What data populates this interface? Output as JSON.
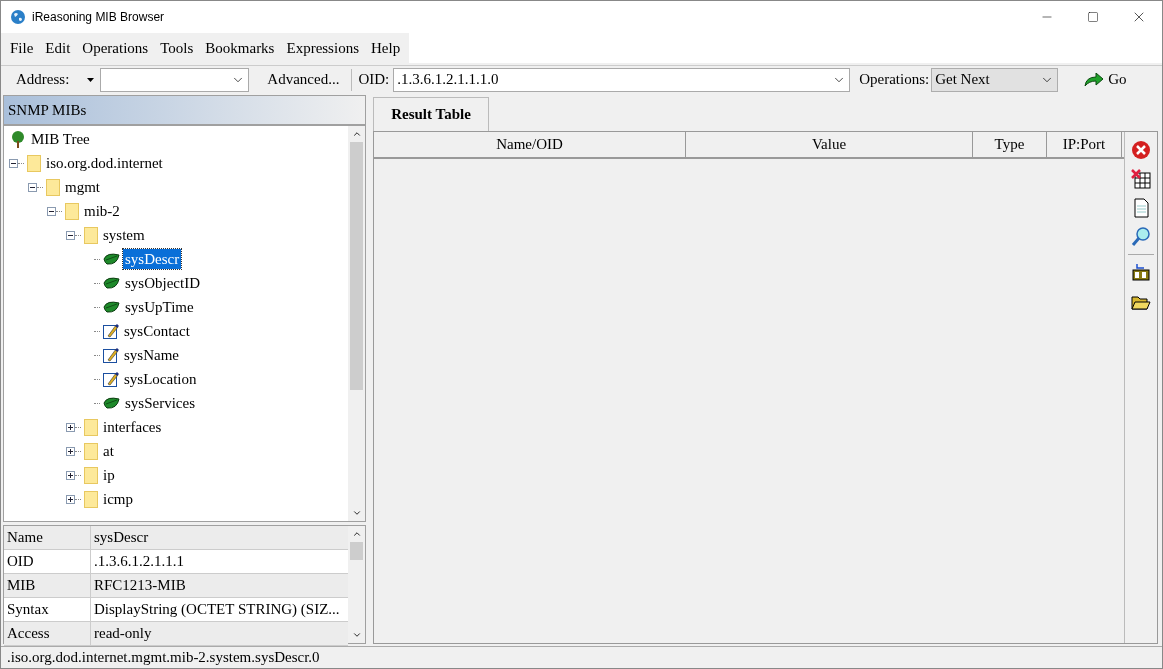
{
  "window": {
    "title": "iReasoning MIB Browser"
  },
  "menu": [
    "File",
    "Edit",
    "Operations",
    "Tools",
    "Bookmarks",
    "Expressions",
    "Help"
  ],
  "toolbar": {
    "address_label": "Address:",
    "advanced_button": "Advanced...",
    "oid_label": "OID:",
    "oid_value": ".1.3.6.1.2.1.1.1.0",
    "operations_label": "Operations:",
    "operations_value": "Get Next",
    "go_button": "Go"
  },
  "mib_panel": {
    "title": "SNMP MIBs",
    "tree": [
      {
        "label": "MIB Tree",
        "kind": "root",
        "selected": false,
        "children": [
          {
            "label": "iso.org.dod.internet",
            "kind": "folder",
            "expanded": true,
            "selected": false,
            "children": [
              {
                "label": "mgmt",
                "kind": "folder",
                "expanded": true,
                "selected": false,
                "children": [
                  {
                    "label": "mib-2",
                    "kind": "folder",
                    "expanded": true,
                    "selected": false,
                    "children": [
                      {
                        "label": "system",
                        "kind": "folder",
                        "expanded": true,
                        "selected": false,
                        "children": [
                          {
                            "label": "sysDescr",
                            "kind": "leaf",
                            "selected": true
                          },
                          {
                            "label": "sysObjectID",
                            "kind": "leaf",
                            "selected": false
                          },
                          {
                            "label": "sysUpTime",
                            "kind": "leaf",
                            "selected": false
                          },
                          {
                            "label": "sysContact",
                            "kind": "writable",
                            "selected": false
                          },
                          {
                            "label": "sysName",
                            "kind": "writable",
                            "selected": false
                          },
                          {
                            "label": "sysLocation",
                            "kind": "writable",
                            "selected": false
                          },
                          {
                            "label": "sysServices",
                            "kind": "leaf",
                            "selected": false
                          }
                        ]
                      },
                      {
                        "label": "interfaces",
                        "kind": "folder",
                        "expanded": false,
                        "selected": false
                      },
                      {
                        "label": "at",
                        "kind": "folder",
                        "expanded": false,
                        "selected": false
                      },
                      {
                        "label": "ip",
                        "kind": "folder",
                        "expanded": false,
                        "selected": false
                      },
                      {
                        "label": "icmp",
                        "kind": "folder",
                        "expanded": false,
                        "selected": false
                      }
                    ]
                  }
                ]
              }
            ]
          }
        ]
      }
    ],
    "properties": [
      {
        "name": "Name",
        "value": "sysDescr"
      },
      {
        "name": "OID",
        "value": ".1.3.6.1.2.1.1.1"
      },
      {
        "name": "MIB",
        "value": "RFC1213-MIB"
      },
      {
        "name": "Syntax",
        "value": "DisplayString (OCTET STRING) (SIZ..."
      },
      {
        "name": "Access",
        "value": "read-only"
      }
    ]
  },
  "result_tab": {
    "label": "Result Table",
    "selected": true
  },
  "result_table": {
    "columns": [
      "Name/OID",
      "Value",
      "Type",
      "IP:Port"
    ]
  },
  "status_bar": ".iso.org.dod.internet.mgmt.mib-2.system.sysDescr.0"
}
